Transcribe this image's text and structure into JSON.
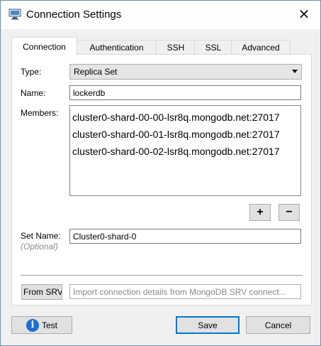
{
  "window": {
    "title": "Connection Settings",
    "close_glyph": "✕"
  },
  "tabs": [
    {
      "label": "Connection",
      "active": true
    },
    {
      "label": "Authentication",
      "active": false
    },
    {
      "label": "SSH",
      "active": false
    },
    {
      "label": "SSL",
      "active": false
    },
    {
      "label": "Advanced",
      "active": false
    }
  ],
  "form": {
    "type_label": "Type:",
    "type_value": "Replica Set",
    "name_label": "Name:",
    "name_value": "lockerdb",
    "members_label": "Members:",
    "members": [
      "cluster0-shard-00-00-lsr8q.mongodb.net:27017",
      "cluster0-shard-00-01-lsr8q.mongodb.net:27017",
      "cluster0-shard-00-02-lsr8q.mongodb.net:27017"
    ],
    "add_label": "+",
    "remove_label": "−",
    "set_name_label": "Set Name:",
    "set_name_hint": "(Optional)",
    "set_name_value": "Cluster0-shard-0",
    "from_srv_label": "From SRV",
    "srv_placeholder": "Import connection details from MongoDB SRV connect..."
  },
  "footer": {
    "test_label": "Test",
    "save_label": "Save",
    "cancel_label": "Cancel"
  },
  "icons": {
    "app": "window-app-icon",
    "close": "close-icon",
    "info": "info-icon",
    "dropdown": "chevron-down-icon"
  },
  "colors": {
    "accent": "#0078d7",
    "info": "#1f6fd1",
    "button_face": "#e1e1e1",
    "dialog_bg": "#f0f0f0"
  }
}
